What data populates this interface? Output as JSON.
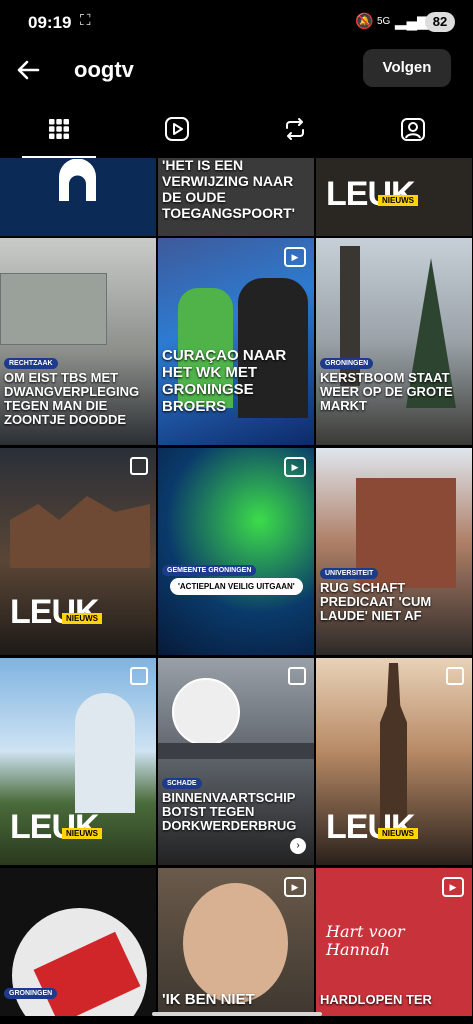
{
  "status": {
    "time": "09:19",
    "battery": "82",
    "network": "5G"
  },
  "header": {
    "username": "oogtv",
    "follow_label": "Volgen"
  },
  "tabs": [
    "grid",
    "reels",
    "reposts",
    "tagged"
  ],
  "posts": [
    {
      "caption": "",
      "badge": "",
      "type": "logo"
    },
    {
      "caption": "'HET IS EEN VERWIJZING NAAR DE OUDE TOEGANGSPOORT'",
      "badge": "",
      "type": "text"
    },
    {
      "caption": "",
      "badge": "",
      "type": "leuk"
    },
    {
      "caption": "OM EIST TBS MET DWANGVERPLEGING TEGEN MAN DIE ZOONTJE DOODDE",
      "badge": "RECHTZAAK",
      "type": "text"
    },
    {
      "caption": "CURAÇAO NAAR HET WK MET GRONINGSE BROERS",
      "badge": "",
      "type": "video"
    },
    {
      "caption": "KERSTBOOM STAAT WEER OP DE GROTE MARKT",
      "badge": "GRONINGEN",
      "type": "text"
    },
    {
      "caption": "",
      "badge": "",
      "type": "leuk"
    },
    {
      "caption": "'ACTIEPLAN VEILIG UITGAAN'",
      "badge": "GEMEENTE GRONINGEN",
      "type": "video"
    },
    {
      "caption": "RUG SCHAFT PREDICAAT 'CUM LAUDE' NIET AF",
      "badge": "UNIVERSITEIT",
      "type": "text"
    },
    {
      "caption": "",
      "badge": "",
      "type": "leuk"
    },
    {
      "caption": "BINNENVAARTSCHIP BOTST TEGEN DORKWERDERBRUG",
      "badge": "SCHADE",
      "type": "text"
    },
    {
      "caption": "",
      "badge": "",
      "type": "leuk"
    },
    {
      "caption": "",
      "badge": "GRONINGEN",
      "type": "text"
    },
    {
      "caption": "'IK BEN NIET",
      "badge": "",
      "type": "video"
    },
    {
      "caption": "HARDLOPEN TER",
      "badge": "",
      "type": "video"
    }
  ],
  "leuk": {
    "word": "LEUK",
    "tag": "NIEUWS"
  },
  "hart": "Hart voor Hannah"
}
